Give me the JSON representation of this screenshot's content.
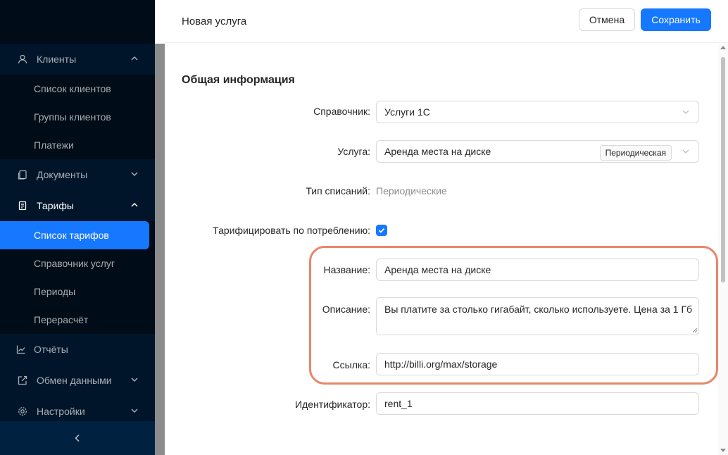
{
  "sidebar": {
    "groups": [
      {
        "label": "Клиенты",
        "icon": "user-icon",
        "expanded": true,
        "items": [
          {
            "label": "Список клиентов"
          },
          {
            "label": "Группы клиентов"
          },
          {
            "label": "Платежи"
          }
        ]
      },
      {
        "label": "Документы",
        "icon": "document-icon",
        "expanded": false
      },
      {
        "label": "Тарифы",
        "icon": "tariff-icon",
        "expanded": true,
        "items": [
          {
            "label": "Список тарифов",
            "active": true
          },
          {
            "label": "Справочник услуг"
          },
          {
            "label": "Периоды"
          },
          {
            "label": "Перерасчёт"
          }
        ]
      },
      {
        "label": "Отчёты",
        "icon": "chart-icon",
        "expanded": false
      },
      {
        "label": "Обмен данными",
        "icon": "exchange-icon",
        "expanded": false
      },
      {
        "label": "Настройки",
        "icon": "gear-icon",
        "expanded": false
      }
    ],
    "collapse_icon": "chevron-left-icon"
  },
  "drawer": {
    "title": "Новая услуга",
    "cancel_label": "Отмена",
    "save_label": "Сохранить",
    "section_title": "Общая информация",
    "fields": {
      "directory": {
        "label": "Справочник:",
        "value": "Услуги 1С"
      },
      "service": {
        "label": "Услуга:",
        "value": "Аренда места на диске",
        "tag": "Периодическая"
      },
      "charge_type": {
        "label": "Тип списаний:",
        "value": "Периодические"
      },
      "usage_billing": {
        "label": "Тарифицировать по потреблению:",
        "checked": true
      },
      "name": {
        "label": "Название:",
        "value": "Аренда места на диске"
      },
      "description": {
        "label": "Описание:",
        "value": "Вы платите за столько гигабайт, сколько используете. Цена за 1 Гб"
      },
      "link": {
        "label": "Ссылка:",
        "value": "http://billi.org/max/storage"
      },
      "identifier": {
        "label": "Идентификатор:",
        "value": "rent_1"
      }
    }
  },
  "colors": {
    "accent": "#1677ff",
    "sidebar_bg": "#001529",
    "highlight": "#e8866a"
  }
}
